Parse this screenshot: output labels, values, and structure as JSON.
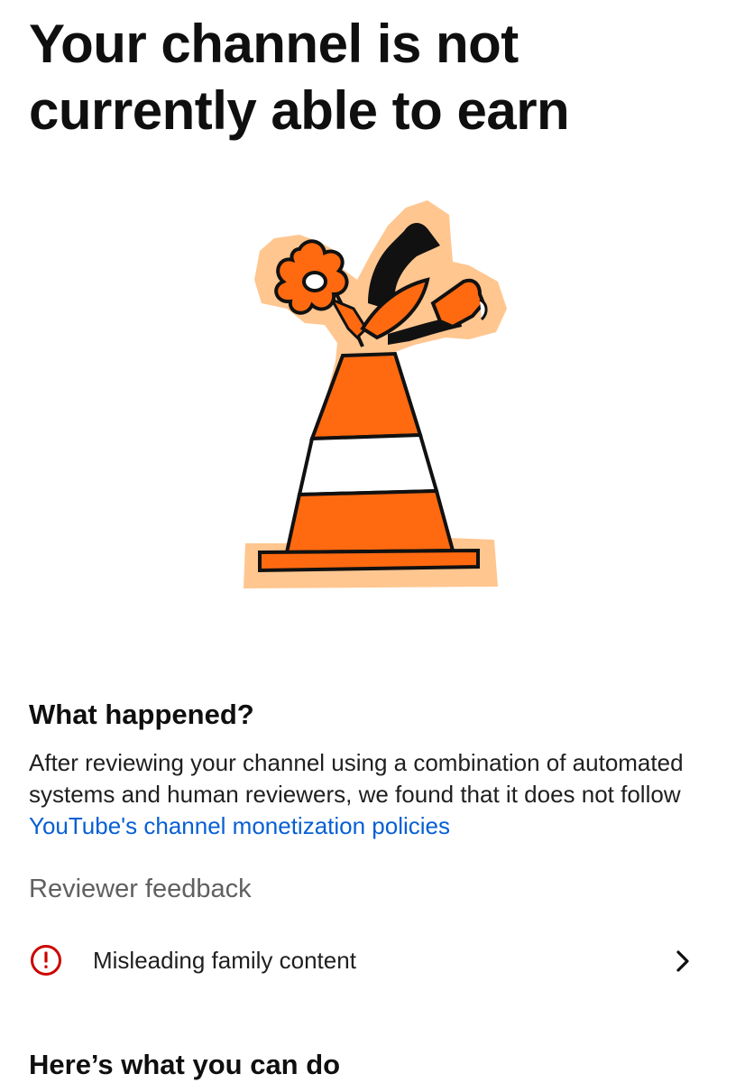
{
  "page": {
    "title": "Your channel is not currently able to earn"
  },
  "illustration": {
    "name": "traffic-cone-with-flowers",
    "colors": {
      "orange": "#ff6a10",
      "peach": "#ffc690",
      "outline": "#111111"
    }
  },
  "what_happened": {
    "heading": "What happened?",
    "body_prefix": "After reviewing your channel using a combination of automated systems and human reviewers, we found that it does not follow ",
    "link_text": "YouTube's channel monetization policies"
  },
  "reviewer_feedback": {
    "heading": "Reviewer feedback",
    "items": [
      {
        "label": "Misleading family content",
        "icon": "alert-circle-icon",
        "icon_color": "#cc0000"
      }
    ]
  },
  "next_steps": {
    "heading": "Here’s what you can do"
  },
  "colors": {
    "link": "#065fd4",
    "secondary_text": "#606060",
    "alert": "#cc0000"
  }
}
